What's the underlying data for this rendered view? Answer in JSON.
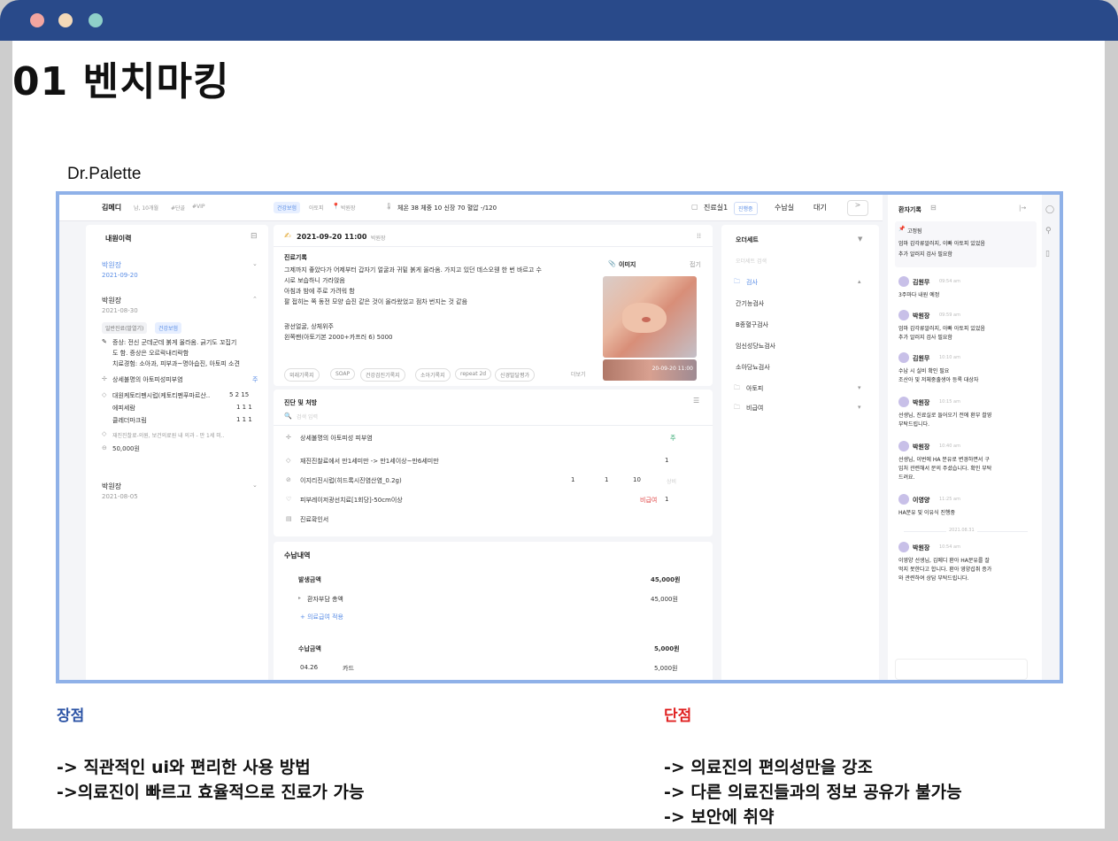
{
  "slide": {
    "title": "01 벤치마킹",
    "app_name": "Dr.Palette",
    "pros_title": "장점",
    "pros": [
      "-> 직관적인 ui와 편리한 사용 방법",
      "->의료진이 빠르고 효율적으로 진료가 가능"
    ],
    "cons_title": "단점",
    "cons": [
      "-> 의료진의 편의성만을 강조",
      "-> 다른 의료진들과의 정보 공유가 불가능",
      "-> 보안에 취약"
    ],
    "colors": {
      "topbar": "#294a8a",
      "pros": "#2e55a6",
      "cons": "#e02020",
      "frame": "#8fb1e8"
    }
  },
  "header": {
    "patient": "김메디",
    "patient_meta": "남, 10개월",
    "tags": [
      "#단골",
      "#VIP"
    ],
    "insurance": "건강보험",
    "allergy": "아토피",
    "doctor": "박원장",
    "vitals": "체온 38  체중 10  신장 70  혈압 -/120",
    "room": "진료실1",
    "room_status": "진행중",
    "payment": "수납실",
    "payment_status": "대기"
  },
  "history": {
    "title": "내원이력",
    "visits": [
      {
        "doctor": "박원장",
        "date": "2021-09-20"
      },
      {
        "doctor": "박원장",
        "date": "2021-08-30"
      },
      {
        "doctor": "박원장",
        "date": "2021-08-05"
      }
    ],
    "badges": [
      "일반진료(발열기)",
      "건강보험"
    ],
    "symptom": "증상: 전신 군데군데 붉게 올라옴. 긁기도 꼬집기도 함. 증상은 오르락내리락함",
    "symptom_l1": "증상: 전신 군데군데 붉게 올라옴. 긁기도 꼬집기",
    "symptom_l2": "도 함. 증상은 오르락내리락함",
    "symptom_l3": "치료경험: 소아과, 피부과~명아습진, 아토피 소견",
    "diagnosis": "상세불명의 아토피성피부염",
    "diagnosis_mark": "주",
    "drug": "대원케토티펜시럽(케토티펜푸마르산..",
    "drug_nums": "5  2  15",
    "drug2": "에피세람",
    "drug3": "클레더마크림",
    "ones": "1  1  1",
    "revisit": "재진진찰료-의원, 보건의료원 내 의과 - 만 1세 미..",
    "amount": "50,000원"
  },
  "record": {
    "date": "2021-09-20 11:00",
    "doctor": "박원장",
    "title": "진료기록",
    "lines": [
      "그제까지 좋았다가 어제부터 갑자기 얼굴과 귀밑 붉게 올라옴. 가지고 있던 데스오웬 한 번 바르고 수",
      "시로 보습하니 가라앉음",
      "아침과 밤에 주로 가려워 함",
      "팔 접히는 쪽 동전 모양 습진 같은 것이 올라왔었고 점차 번지는 것 같음",
      "",
      "광선얼굴, 상체위주",
      "왼쪽팬(아토기본 2000+카프러 6) 5000"
    ],
    "image_label": "이미지",
    "image_toggle": "접기",
    "image_time": "20-09-20 11:00",
    "tags": [
      "외래기록지",
      "SOAP",
      "건강검진기록지",
      "소아기록지",
      "repeat 2d",
      "신경발달평가"
    ],
    "more": "더보기"
  },
  "prescription": {
    "title": "진단 및 처방",
    "search": "검색 입력",
    "rows": [
      {
        "name": "상세불명의 아토피성 피부염",
        "mark": "주"
      },
      {
        "name": "재진진찰료에서 만1세미만 -> 만1세이상~만6세미만",
        "q": "1"
      },
      {
        "name": "이지리진시럽(히드록시진염산염_0.2g)",
        "a": "1",
        "b": "1",
        "c": "10",
        "d": "상비"
      },
      {
        "name": "피부레이저광선치료[1회당]-50cm이상",
        "tag": "비급여",
        "q": "1"
      },
      {
        "name": "진료확인서"
      }
    ]
  },
  "payment_card": {
    "title": "수납내역",
    "total_label": "발생금액",
    "total": "45,000원",
    "self_label": "환자부담 총액",
    "self": "45,000원",
    "add_label": "+ 의료급여 적용",
    "paid_label": "수납금액",
    "paid": "5,000원",
    "row_date": "04.26",
    "row_method": "카드",
    "row_amount": "5,000원"
  },
  "orderset": {
    "title": "오더세트",
    "search": "오더세트 검색",
    "items": [
      "검사",
      "간기능검사",
      "B종혈구검사",
      "임신성당뇨검사",
      "소아당뇨검사",
      "아토피",
      "비급여"
    ]
  },
  "chat": {
    "title": "환자기록",
    "pinned_author": "고정됨",
    "pinned_text": [
      "엄마 갑각류알러지, 이빠 아토피 있었음",
      "추가 알러지 검사 필요함"
    ],
    "date_divider": "2021.08.31",
    "messages": [
      {
        "author": "김원무",
        "time": "09:54 am",
        "lines": [
          "3주마다 내원 예정"
        ]
      },
      {
        "author": "박원장",
        "time": "09:59 am",
        "lines": [
          "엄마 갑각류알러지, 아빠 아토피 있었음",
          "추가 알러지 검사 필요함"
        ]
      },
      {
        "author": "김원무",
        "time": "10:10 am",
        "lines": [
          "수납 시 실비 확인 필요",
          "조산아 및 저체중출생아 등록 대상자"
        ]
      },
      {
        "author": "박원장",
        "time": "10:15 am",
        "lines": [
          "선생님, 진료실로 들어오기 전에 환부 촬영",
          "부탁드립니다."
        ]
      },
      {
        "author": "박원장",
        "time": "10:40 am",
        "lines": [
          "선생님, 이번에 HA 분유로 변경하면서 구",
          "입처 관련해서 문의 주셨습니다. 확인 부탁",
          "드려요."
        ]
      },
      {
        "author": "이영양",
        "time": "11:25 am",
        "lines": [
          "HA분유 및 이유식 진행중"
        ]
      },
      {
        "author": "박원장",
        "time": "10:54 am",
        "lines": [
          "이영양 선생님, 김메디 환아 HA분유를 잘",
          "먹지 못한다고 합니다. 환아 영양섭취 증가",
          "와 관련하여 상담 부탁드립니다."
        ]
      }
    ]
  }
}
